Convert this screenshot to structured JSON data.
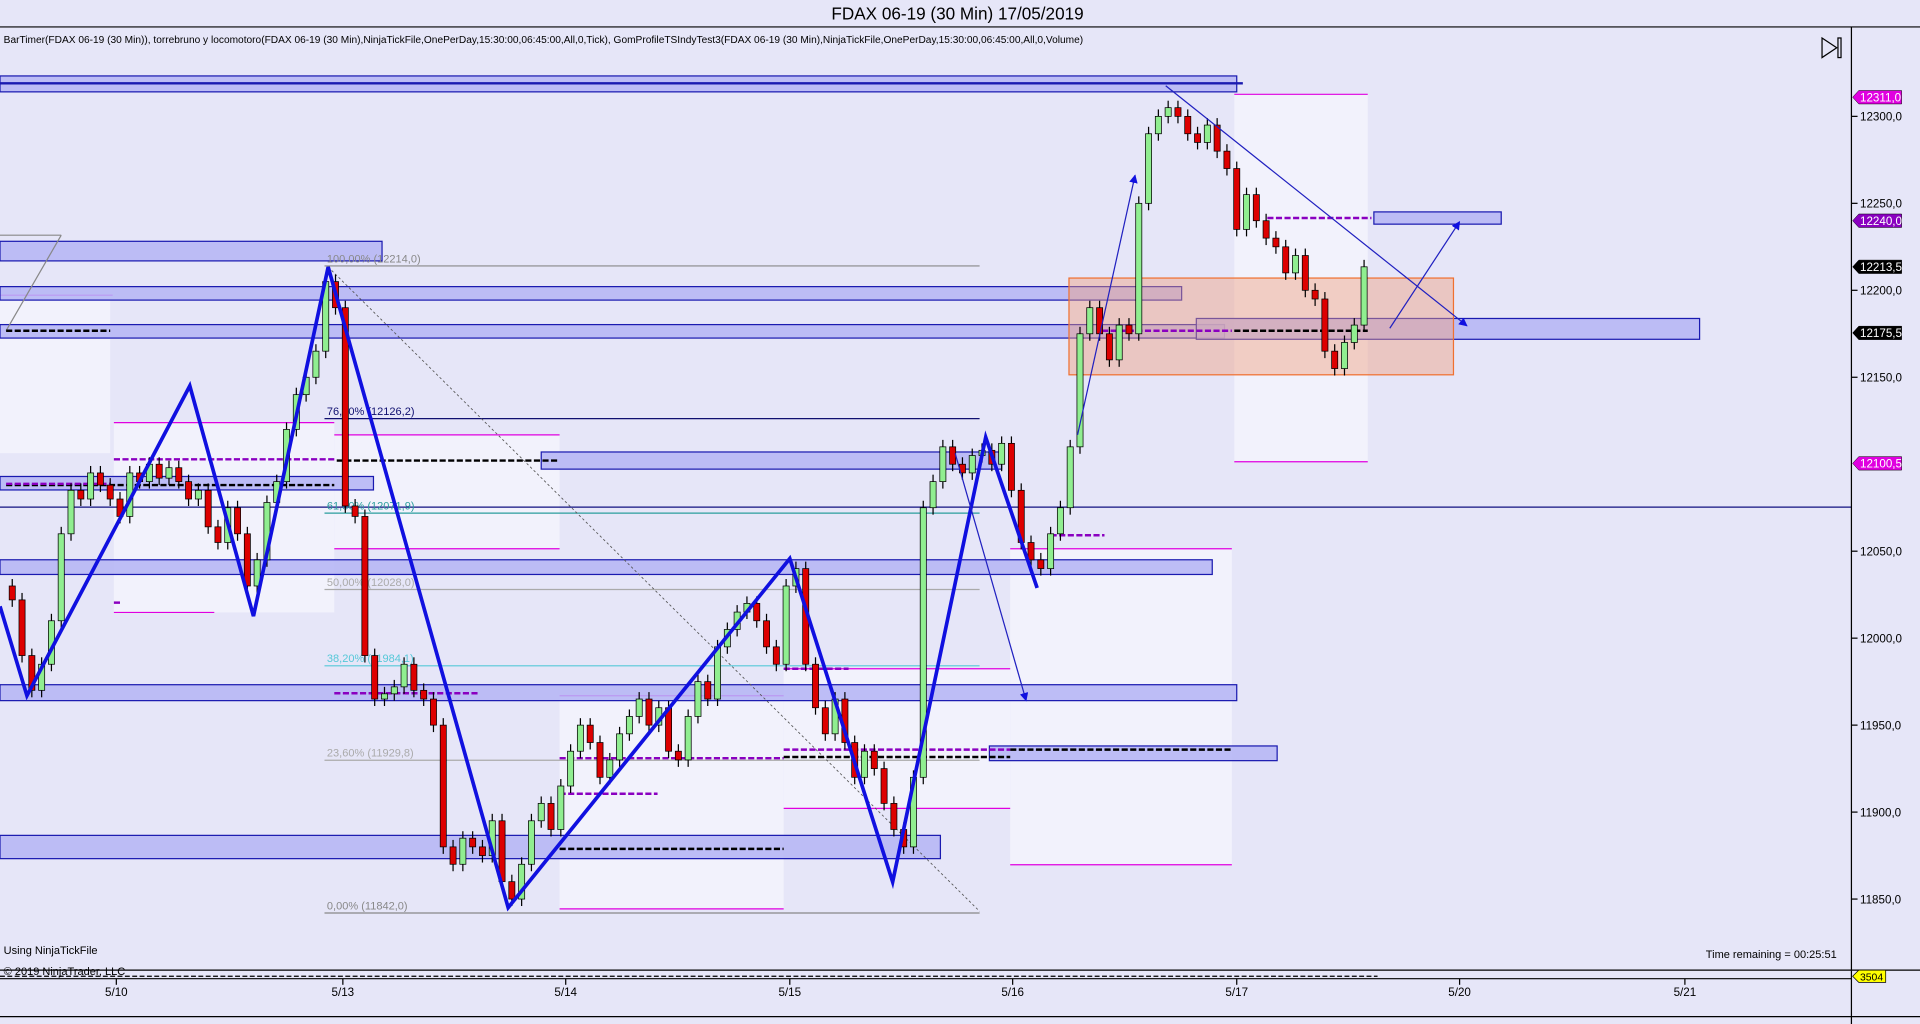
{
  "window": {
    "title": "FDAX 06-19 (30 Min)  17/05/2019"
  },
  "indicators_line": "BarTimer(FDAX 06-19 (30 Min)), torrebruno y locomotoro(FDAX 06-19 (30 Min),NinjaTickFile,OnePerDay,15:30:00,06:45:00,All,0,Tick), GomProfileTSIndyTest3(FDAX 06-19 (30 Min),NinjaTickFile,OnePerDay,15:30:00,06:45:00,All,0,Volume)",
  "footer": {
    "data_source": "Using NinjaTickFile",
    "copyright": "© 2019 NinjaTrader, LLC",
    "time_remaining": "Time remaining = 00:25:51"
  },
  "colors": {
    "up": "#90ee90",
    "down": "#dd0000",
    "zone": "#b4b4f4",
    "zigzag": "#1010e0",
    "fib_teal": "#2a9d9d",
    "magenta": "#e000e0",
    "purple": "#8a00c0",
    "background": "#e6e6f8"
  },
  "icons": {
    "scroll_end": "play-to-end-icon"
  },
  "chart_data": {
    "type": "candlestick",
    "instrument": "FDAX 06-19",
    "interval": "30 Min",
    "y_ticks": [
      "12300,0",
      "12250,0",
      "12200,0",
      "12150,0",
      "12050,0",
      "12000,0",
      "11950,0",
      "11900,0",
      "11850,0"
    ],
    "y_tick_values": [
      12300,
      12250,
      12200,
      12150,
      12050,
      12000,
      11950,
      11900,
      11850
    ],
    "x_ticks": [
      "5/10",
      "5/13",
      "5/14",
      "5/15",
      "5/16",
      "5/17",
      "5/20",
      "5/21"
    ],
    "price_markers": [
      {
        "label": "12311,0",
        "value": 12311.0,
        "color": "#e000e0"
      },
      {
        "label": "12240,0",
        "value": 12240.0,
        "color": "#8a00c0"
      },
      {
        "label": "12213,5",
        "value": 12213.5,
        "color": "#000000"
      },
      {
        "label": "12175,5",
        "value": 12175.5,
        "color": "#000000"
      },
      {
        "label": "12100,5",
        "value": 12100.5,
        "color": "#e000e0"
      }
    ],
    "volume_marker": {
      "label": "3504",
      "color": "#ffff00"
    },
    "fibonacci": [
      {
        "label": "100,00% (12214,0)",
        "value": 12214.0,
        "color": "#888888"
      },
      {
        "label": "76,40% (12126,2)",
        "value": 12126.2,
        "color": "#101070"
      },
      {
        "label": "61,80% (12071,9)",
        "value": 12071.9,
        "color": "#2a9d9d"
      },
      {
        "label": "50,00% (12028,0)",
        "value": 12028.0,
        "color": "#aaaaaa"
      },
      {
        "label": "38,20% (11984,1)",
        "value": 11984.1,
        "color": "#55c8d8"
      },
      {
        "label": "23,60% (11929,8)",
        "value": 11929.8,
        "color": "#aaaaaa"
      },
      {
        "label": "0,00% (11842,0)",
        "value": 11842.0,
        "color": "#888888"
      }
    ],
    "closes": [
      12022,
      11990,
      11970,
      11985,
      12010,
      12060,
      12085,
      12080,
      12095,
      12088,
      12080,
      12070,
      12095,
      12090,
      12100,
      12092,
      12098,
      12090,
      12080,
      12085,
      12064,
      12055,
      12075,
      12060,
      12030,
      12045,
      12078,
      12090,
      12120,
      12140,
      12150,
      12165,
      12205,
      12190,
      12076,
      12070,
      11990,
      11965,
      11968,
      11972,
      11985,
      11970,
      11965,
      11950,
      11880,
      11870,
      11885,
      11880,
      11875,
      11895,
      11860,
      11850,
      11870,
      11895,
      11905,
      11890,
      11915,
      11935,
      11950,
      11940,
      11920,
      11930,
      11945,
      11955,
      11965,
      11950,
      11960,
      11935,
      11930,
      11955,
      11975,
      11965,
      11995,
      12005,
      12015,
      12020,
      12010,
      11995,
      11985,
      12030,
      12040,
      11985,
      11960,
      11945,
      11965,
      11940,
      11920,
      11935,
      11925,
      11905,
      11890,
      11880,
      11920,
      12075,
      12090,
      12110,
      12100,
      12095,
      12105,
      12108,
      12100,
      12112,
      12085,
      12055,
      12045,
      12040,
      12060,
      12075,
      12110,
      12175,
      12190,
      12175,
      12160,
      12180,
      12175,
      12250,
      12290,
      12300,
      12305,
      12300,
      12290,
      12285,
      12295,
      12280,
      12270,
      12235,
      12255,
      12240,
      12230,
      12225,
      12210,
      12220,
      12200,
      12195,
      12165,
      12155,
      12170,
      12180,
      12213.5
    ]
  }
}
